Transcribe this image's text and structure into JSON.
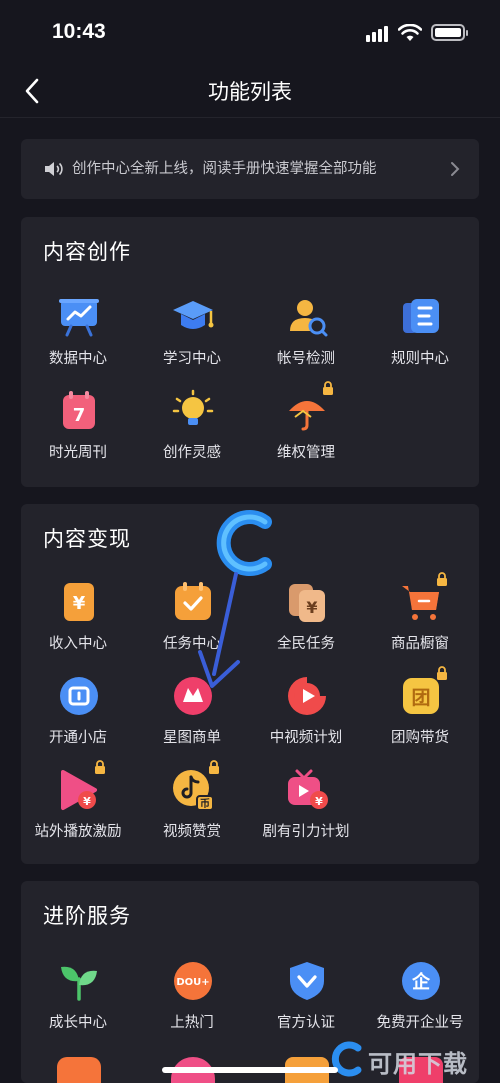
{
  "status_bar": {
    "time": "10:43"
  },
  "nav": {
    "title": "功能列表"
  },
  "notice": {
    "text": "创作中心全新上线，阅读手册快速掌握全部功能"
  },
  "sections": {
    "content_creation": {
      "title": "内容创作",
      "items": [
        {
          "label": "数据中心",
          "icon": "data-center-icon"
        },
        {
          "label": "学习中心",
          "icon": "learning-center-icon"
        },
        {
          "label": "帐号检测",
          "icon": "account-check-icon"
        },
        {
          "label": "规则中心",
          "icon": "rules-center-icon"
        },
        {
          "label": "时光周刊",
          "icon": "weekly-icon"
        },
        {
          "label": "创作灵感",
          "icon": "inspiration-icon"
        },
        {
          "label": "维权管理",
          "icon": "rights-protection-icon",
          "locked": true
        }
      ]
    },
    "content_monetization": {
      "title": "内容变现",
      "items": [
        {
          "label": "收入中心",
          "icon": "income-center-icon"
        },
        {
          "label": "任务中心",
          "icon": "task-center-icon"
        },
        {
          "label": "全民任务",
          "icon": "public-task-icon"
        },
        {
          "label": "商品橱窗",
          "icon": "shop-window-icon",
          "locked": true
        },
        {
          "label": "开通小店",
          "icon": "open-store-icon"
        },
        {
          "label": "星图商单",
          "icon": "star-map-icon"
        },
        {
          "label": "中视频计划",
          "icon": "mid-video-icon"
        },
        {
          "label": "团购带货",
          "icon": "group-buy-icon",
          "locked": true
        },
        {
          "label": "站外播放激励",
          "icon": "external-play-icon",
          "locked": true
        },
        {
          "label": "视频赞赏",
          "icon": "video-reward-icon",
          "locked": true
        },
        {
          "label": "剧有引力计划",
          "icon": "drama-plan-icon"
        }
      ]
    },
    "advanced_services": {
      "title": "进阶服务",
      "items": [
        {
          "label": "成长中心",
          "icon": "growth-center-icon"
        },
        {
          "label": "上热门",
          "icon": "dou-plus-icon"
        },
        {
          "label": "官方认证",
          "icon": "official-verify-icon"
        },
        {
          "label": "免费开企业号",
          "icon": "enterprise-account-icon"
        }
      ]
    }
  },
  "watermark": {
    "text": "可用下载"
  },
  "colors": {
    "background": "#16161e",
    "card": "#23232b",
    "accent_blue": "#3d7cf0",
    "accent_orange": "#f5a03a",
    "accent_red": "#f04b4b"
  }
}
